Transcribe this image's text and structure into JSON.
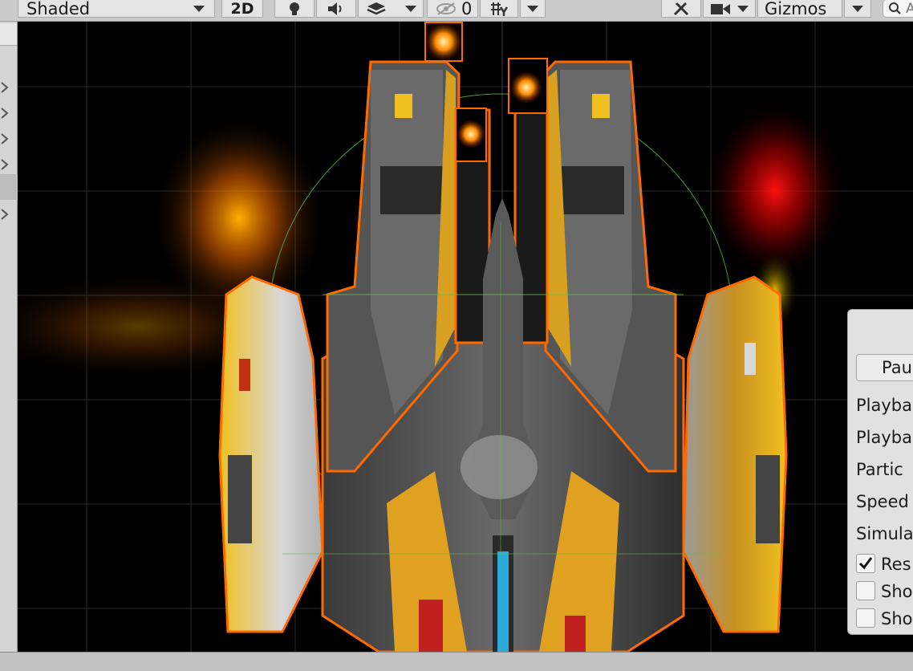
{
  "toolbar": {
    "shading_mode": "Shaded",
    "mode_2d": "2D",
    "hidden_count": "0",
    "gizmos": "Gizmos",
    "search_placeholder": "All"
  },
  "particle_panel": {
    "pause_label": "Pau",
    "rows": [
      "Playba",
      "Playba",
      "Partic",
      "Speed",
      "Simula"
    ],
    "checkboxes": [
      {
        "label": "Res",
        "checked": true
      },
      {
        "label": "Sho",
        "checked": false
      },
      {
        "label": "Sho",
        "checked": false
      }
    ]
  },
  "colors": {
    "selection_outline": "#ff6a00",
    "grid": "#3a3a3a",
    "gizmo_circle": "#5fbf3f"
  },
  "icons": [
    "lightbulb-icon",
    "audio-icon",
    "effects-layers-icon",
    "visibility-eye-icon",
    "grid-snap-icon",
    "tools-icon",
    "camera-icon",
    "search-icon"
  ]
}
